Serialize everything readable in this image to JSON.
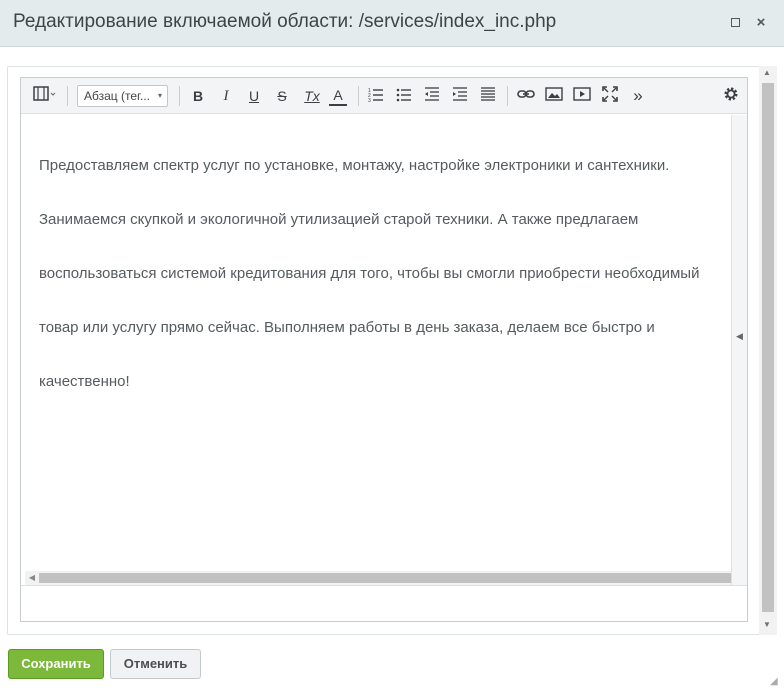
{
  "window": {
    "title": "Редактирование включаемой области: /services/index_inc.php",
    "maximize_icon": "maximize-icon",
    "close_symbol": "×"
  },
  "toolbar": {
    "source_mode_icon": "code-view-icon",
    "format_select": {
      "value": "Абзац (тег...",
      "caret": "▾"
    },
    "bold": "B",
    "italic": "I",
    "underline": "U",
    "strike": "S",
    "remove_format": "Tx",
    "font_color": "A",
    "more_symbol": "»",
    "icons": [
      "ordered-list-icon",
      "bullet-list-icon",
      "outdent-icon",
      "indent-icon",
      "align-icon",
      "link-icon",
      "image-icon",
      "video-icon",
      "fullscreen-icon",
      "more-icon",
      "settings-icon"
    ]
  },
  "editor": {
    "lines": [
      "Предоставляем спектр услуг по установке, монтажу, настройке электроники и сантехники.",
      "Занимаемся скупкой и экологичной утилизацией старой техники. А также предлагаем",
      "воспользоваться системой кредитования для того, чтобы вы смогли приобрести необходимый",
      "товар или услугу прямо сейчас. Выполняем работы в день заказа, делаем все быстро и",
      "качественно!"
    ]
  },
  "buttons": {
    "save": "Сохранить",
    "cancel": "Отменить"
  },
  "colors": {
    "title_bar_bg": "#e4ebed",
    "save_button": "#7cb83a",
    "editor_text": "#555b5e"
  }
}
